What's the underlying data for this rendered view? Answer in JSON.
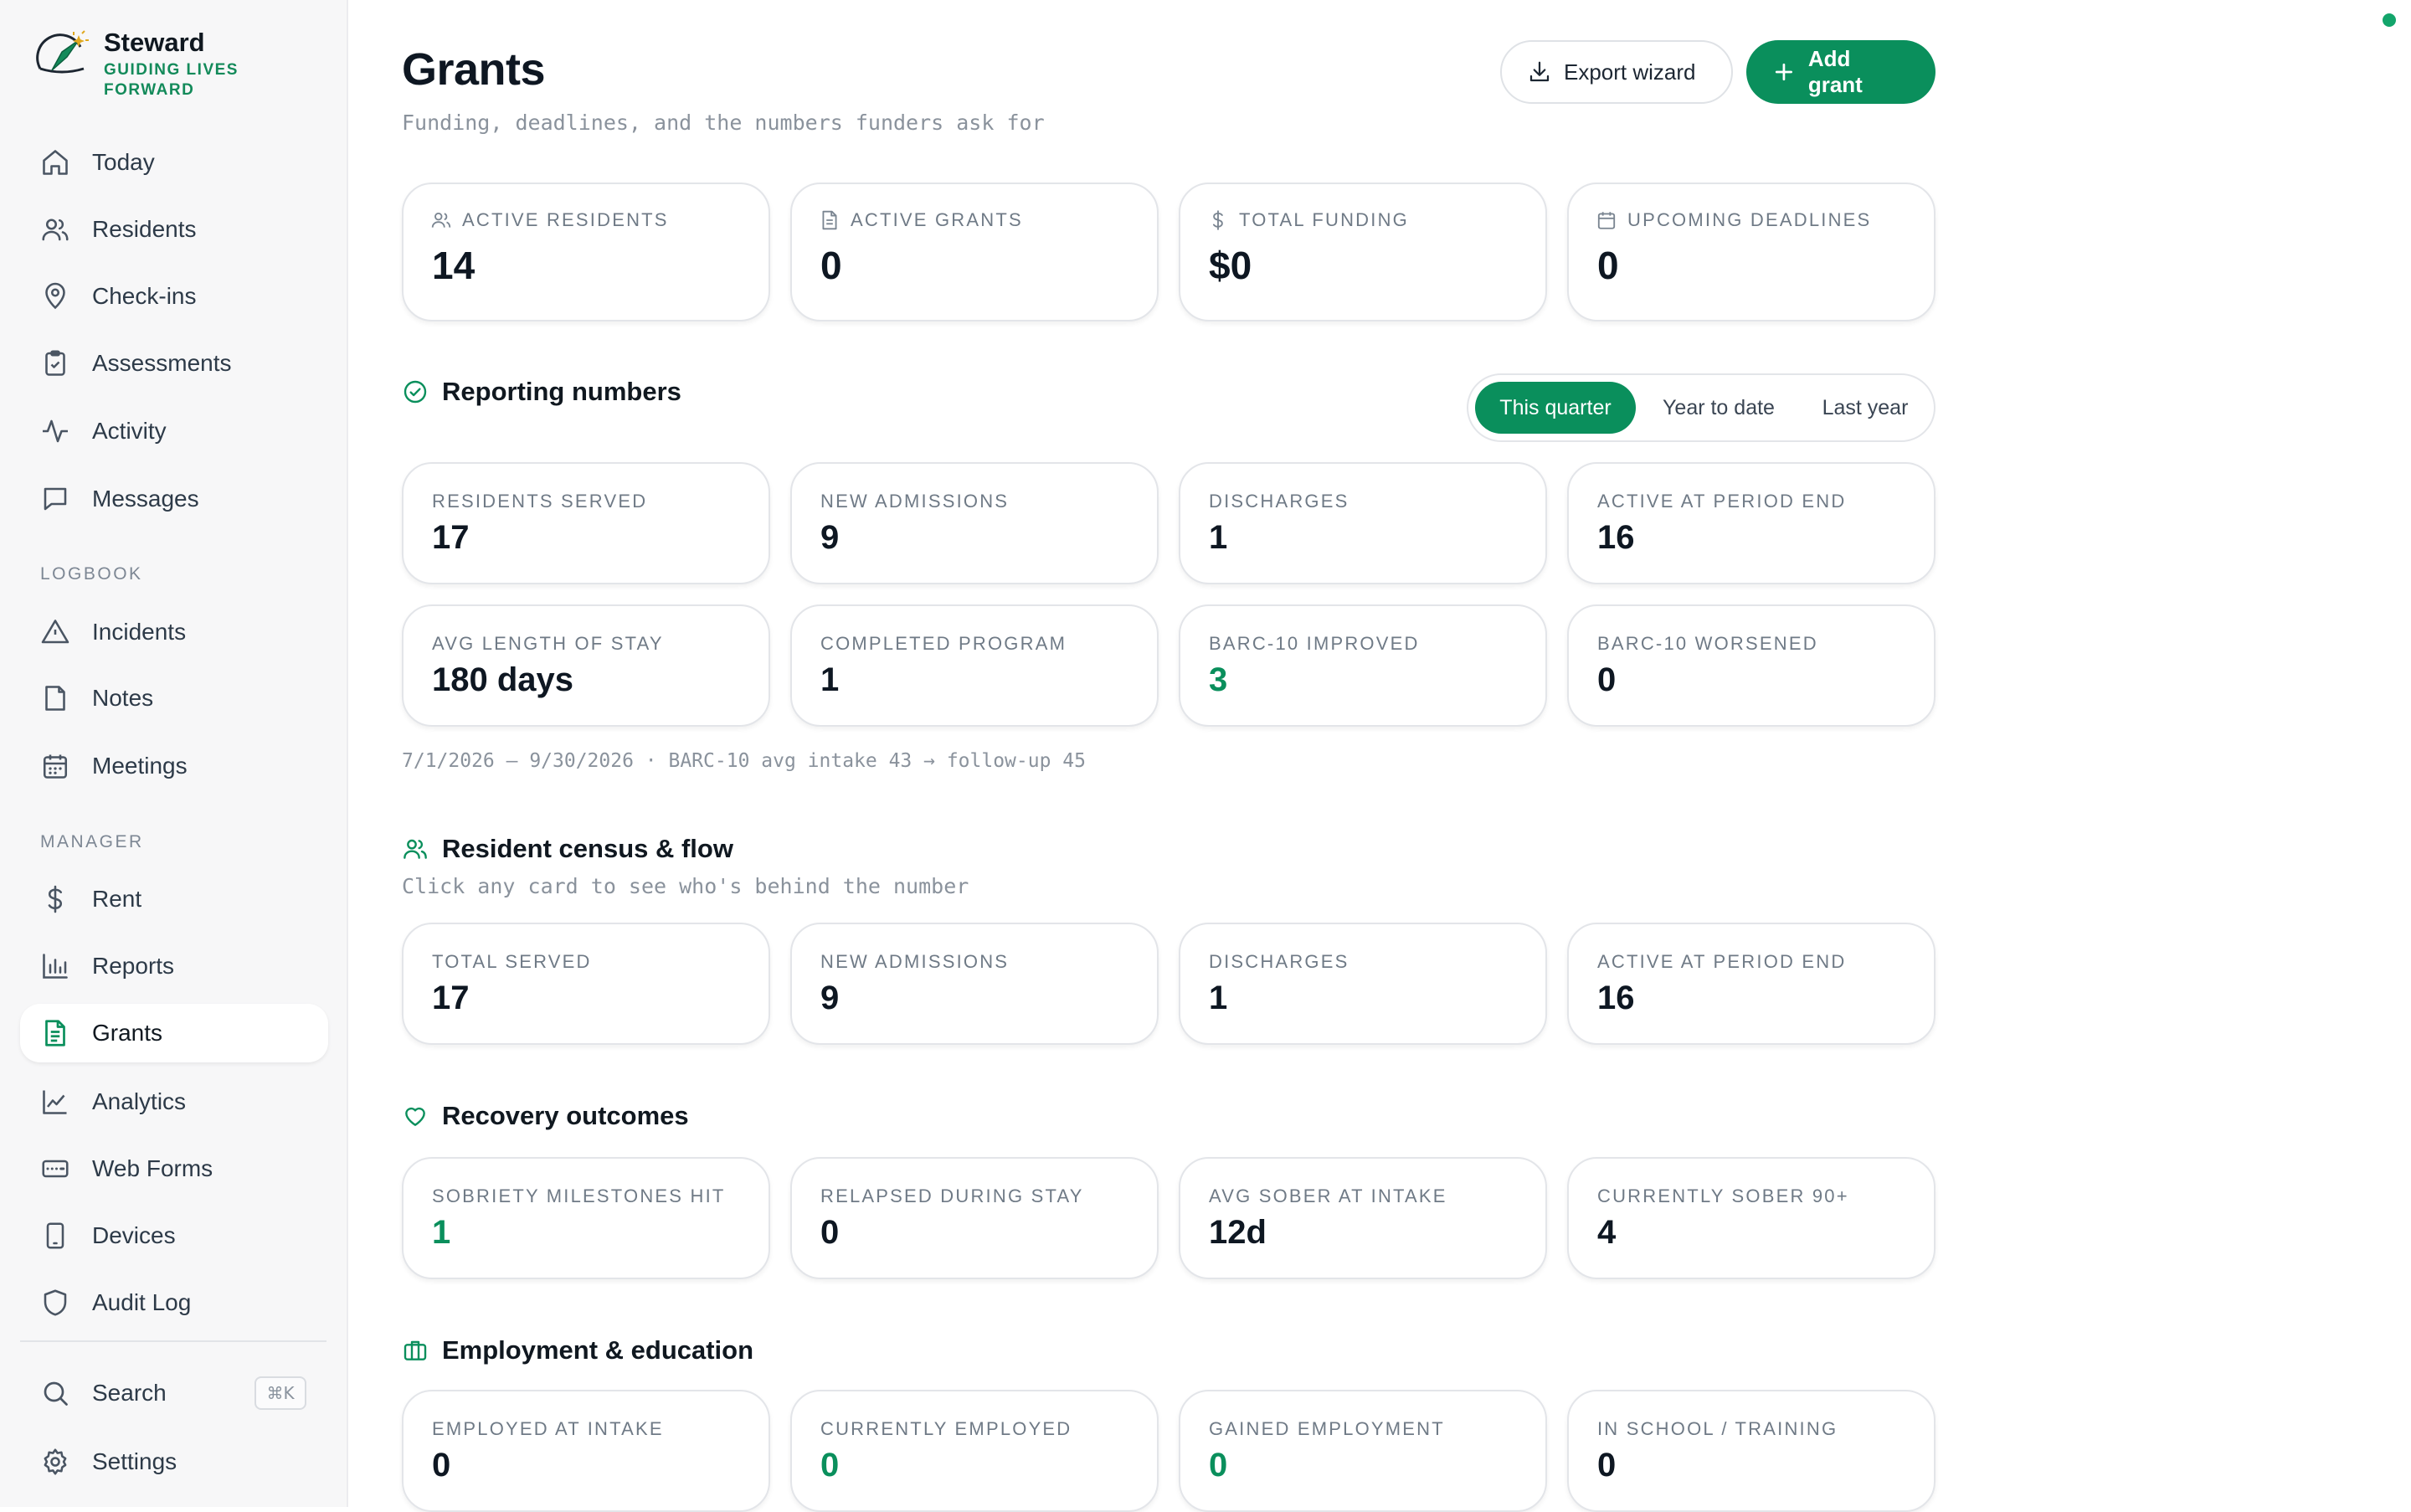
{
  "brand": {
    "name": "Steward",
    "tagline": "GUIDING LIVES FORWARD"
  },
  "sidebar": {
    "items": [
      {
        "label": "Today",
        "icon": "home-icon"
      },
      {
        "label": "Residents",
        "icon": "users-icon"
      },
      {
        "label": "Check-ins",
        "icon": "map-pin-icon"
      },
      {
        "label": "Assessments",
        "icon": "clipboard-check-icon"
      },
      {
        "label": "Activity",
        "icon": "activity-icon"
      },
      {
        "label": "Messages",
        "icon": "message-icon"
      }
    ],
    "logbook_label": "LOGBOOK",
    "logbook": [
      {
        "label": "Incidents",
        "icon": "alert-triangle-icon"
      },
      {
        "label": "Notes",
        "icon": "note-icon"
      },
      {
        "label": "Meetings",
        "icon": "calendar-icon"
      }
    ],
    "manager_label": "MANAGER",
    "manager": [
      {
        "label": "Rent",
        "icon": "dollar-icon"
      },
      {
        "label": "Reports",
        "icon": "bar-chart-icon"
      },
      {
        "label": "Grants",
        "icon": "file-text-icon",
        "active": true
      },
      {
        "label": "Analytics",
        "icon": "line-chart-icon"
      },
      {
        "label": "Web Forms",
        "icon": "form-icon"
      },
      {
        "label": "Devices",
        "icon": "device-icon"
      },
      {
        "label": "Audit Log",
        "icon": "shield-icon"
      }
    ],
    "search": {
      "label": "Search",
      "shortcut": "⌘K"
    },
    "settings": {
      "label": "Settings"
    }
  },
  "header": {
    "title": "Grants",
    "subtitle": "Funding, deadlines, and the numbers funders ask for",
    "export_label": "Export wizard",
    "add_label": "Add grant"
  },
  "summary": [
    {
      "label": "ACTIVE RESIDENTS",
      "value": "14",
      "icon": "users-icon"
    },
    {
      "label": "ACTIVE GRANTS",
      "value": "0",
      "icon": "file-icon"
    },
    {
      "label": "TOTAL FUNDING",
      "value": "$0",
      "icon": "dollar-icon"
    },
    {
      "label": "UPCOMING DEADLINES",
      "value": "0",
      "icon": "calendar-icon"
    }
  ],
  "reporting": {
    "title": "Reporting numbers",
    "periods": [
      "This quarter",
      "Year to date",
      "Last year"
    ],
    "active_period": "This quarter",
    "cards": [
      {
        "label": "RESIDENTS SERVED",
        "value": "17"
      },
      {
        "label": "NEW ADMISSIONS",
        "value": "9"
      },
      {
        "label": "DISCHARGES",
        "value": "1"
      },
      {
        "label": "ACTIVE AT PERIOD END",
        "value": "16"
      },
      {
        "label": "AVG LENGTH OF STAY",
        "value": "180 days"
      },
      {
        "label": "COMPLETED PROGRAM",
        "value": "1"
      },
      {
        "label": "BARC-10 IMPROVED",
        "value": "3",
        "accent": true
      },
      {
        "label": "BARC-10 WORSENED",
        "value": "0"
      }
    ],
    "note": "7/1/2026 – 9/30/2026 · BARC-10 avg intake 43 → follow-up 45"
  },
  "census": {
    "title": "Resident census & flow",
    "subtitle": "Click any card to see who's behind the number",
    "cards": [
      {
        "label": "TOTAL SERVED",
        "value": "17"
      },
      {
        "label": "NEW ADMISSIONS",
        "value": "9"
      },
      {
        "label": "DISCHARGES",
        "value": "1"
      },
      {
        "label": "ACTIVE AT PERIOD END",
        "value": "16"
      }
    ]
  },
  "recovery": {
    "title": "Recovery outcomes",
    "cards": [
      {
        "label": "SOBRIETY MILESTONES HIT",
        "value": "1",
        "accent": true
      },
      {
        "label": "RELAPSED DURING STAY",
        "value": "0"
      },
      {
        "label": "AVG SOBER AT INTAKE",
        "value": "12d"
      },
      {
        "label": "CURRENTLY SOBER 90+",
        "value": "4"
      }
    ]
  },
  "employment": {
    "title": "Employment & education",
    "cards": [
      {
        "label": "EMPLOYED AT INTAKE",
        "value": "0"
      },
      {
        "label": "CURRENTLY EMPLOYED",
        "value": "0",
        "accent": true
      },
      {
        "label": "GAINED EMPLOYMENT",
        "value": "0",
        "accent": true
      },
      {
        "label": "IN SCHOOL / TRAINING",
        "value": "0"
      }
    ]
  },
  "colors": {
    "accent": "#0a8f5c",
    "sidebar_bg": "#f7f7f8",
    "text": "#101820"
  }
}
